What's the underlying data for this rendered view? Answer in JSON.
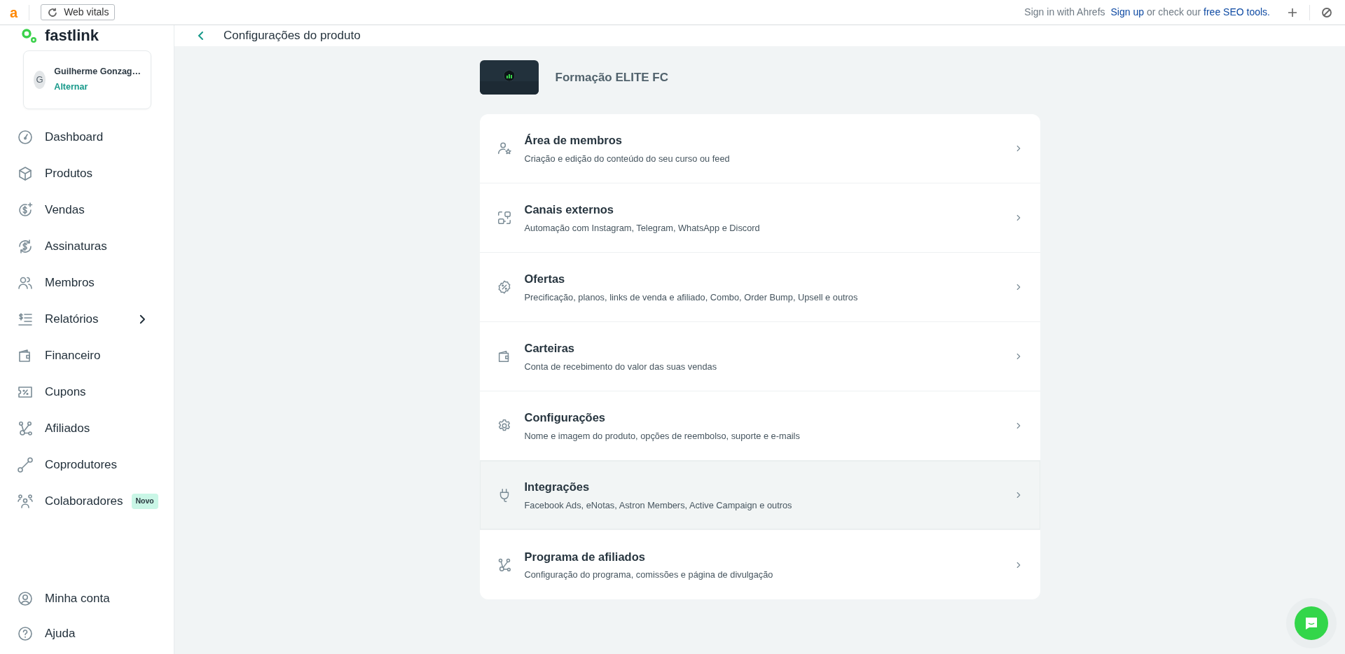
{
  "toolbar": {
    "logo": "a",
    "web_vitals_button": "Web vitals",
    "sign_in": "Sign in with Ahrefs",
    "sign_up": "Sign up",
    "middle": "or check our",
    "seo_tools": "free SEO tools."
  },
  "sidebar": {
    "logo": "fastlink",
    "account": {
      "avatar": "G",
      "name": "Guilherme Gonzag…",
      "switch": "Alternar"
    },
    "items": [
      {
        "label": "Dashboard",
        "kind": "gauge",
        "has_submenu": false
      },
      {
        "label": "Produtos",
        "kind": "box",
        "has_submenu": false
      },
      {
        "label": "Vendas",
        "kind": "dollar-plus",
        "has_submenu": false
      },
      {
        "label": "Assinaturas",
        "kind": "dollar-cycle",
        "has_submenu": false
      },
      {
        "label": "Membros",
        "kind": "users",
        "has_submenu": false
      },
      {
        "label": "Relatórios",
        "kind": "report",
        "has_submenu": true
      },
      {
        "label": "Financeiro",
        "kind": "wallet",
        "has_submenu": false
      },
      {
        "label": "Cupons",
        "kind": "coupon",
        "has_submenu": false
      },
      {
        "label": "Afiliados",
        "kind": "network",
        "has_submenu": false
      },
      {
        "label": "Coprodutores",
        "kind": "link",
        "has_submenu": false
      },
      {
        "label": "Colaboradores",
        "kind": "team",
        "has_submenu": false,
        "badge": "Novo"
      }
    ],
    "footer_items": [
      {
        "label": "Minha conta",
        "kind": "account"
      },
      {
        "label": "Ajuda",
        "kind": "help"
      }
    ]
  },
  "header": {
    "title": "Configurações do produto"
  },
  "product": {
    "name": "Formação ELITE FC"
  },
  "settings": [
    {
      "title": "Área de membros",
      "subtitle": "Criação e edição do conteúdo do seu curso ou feed",
      "kind": "member-star",
      "highlighted": false
    },
    {
      "title": "Canais externos",
      "subtitle": "Automação com Instagram, Telegram, WhatsApp e Discord",
      "kind": "channels",
      "highlighted": false
    },
    {
      "title": "Ofertas",
      "subtitle": "Precificação, planos, links de venda e afiliado, Combo, Order Bump, Upsell e outros",
      "kind": "offer",
      "highlighted": false
    },
    {
      "title": "Carteiras",
      "subtitle": "Conta de recebimento do valor das suas vendas",
      "kind": "wallet",
      "highlighted": false
    },
    {
      "title": "Configurações",
      "subtitle": "Nome e imagem do produto, opções de reembolso, suporte e e-mails",
      "kind": "gear",
      "highlighted": false
    },
    {
      "title": "Integrações",
      "subtitle": "Facebook Ads, eNotas, Astron Members, Active Campaign e outros",
      "kind": "plug",
      "highlighted": true
    },
    {
      "title": "Programa de afiliados",
      "subtitle": "Configuração do programa, comissões e página de divulgação",
      "kind": "network",
      "highlighted": false
    }
  ]
}
